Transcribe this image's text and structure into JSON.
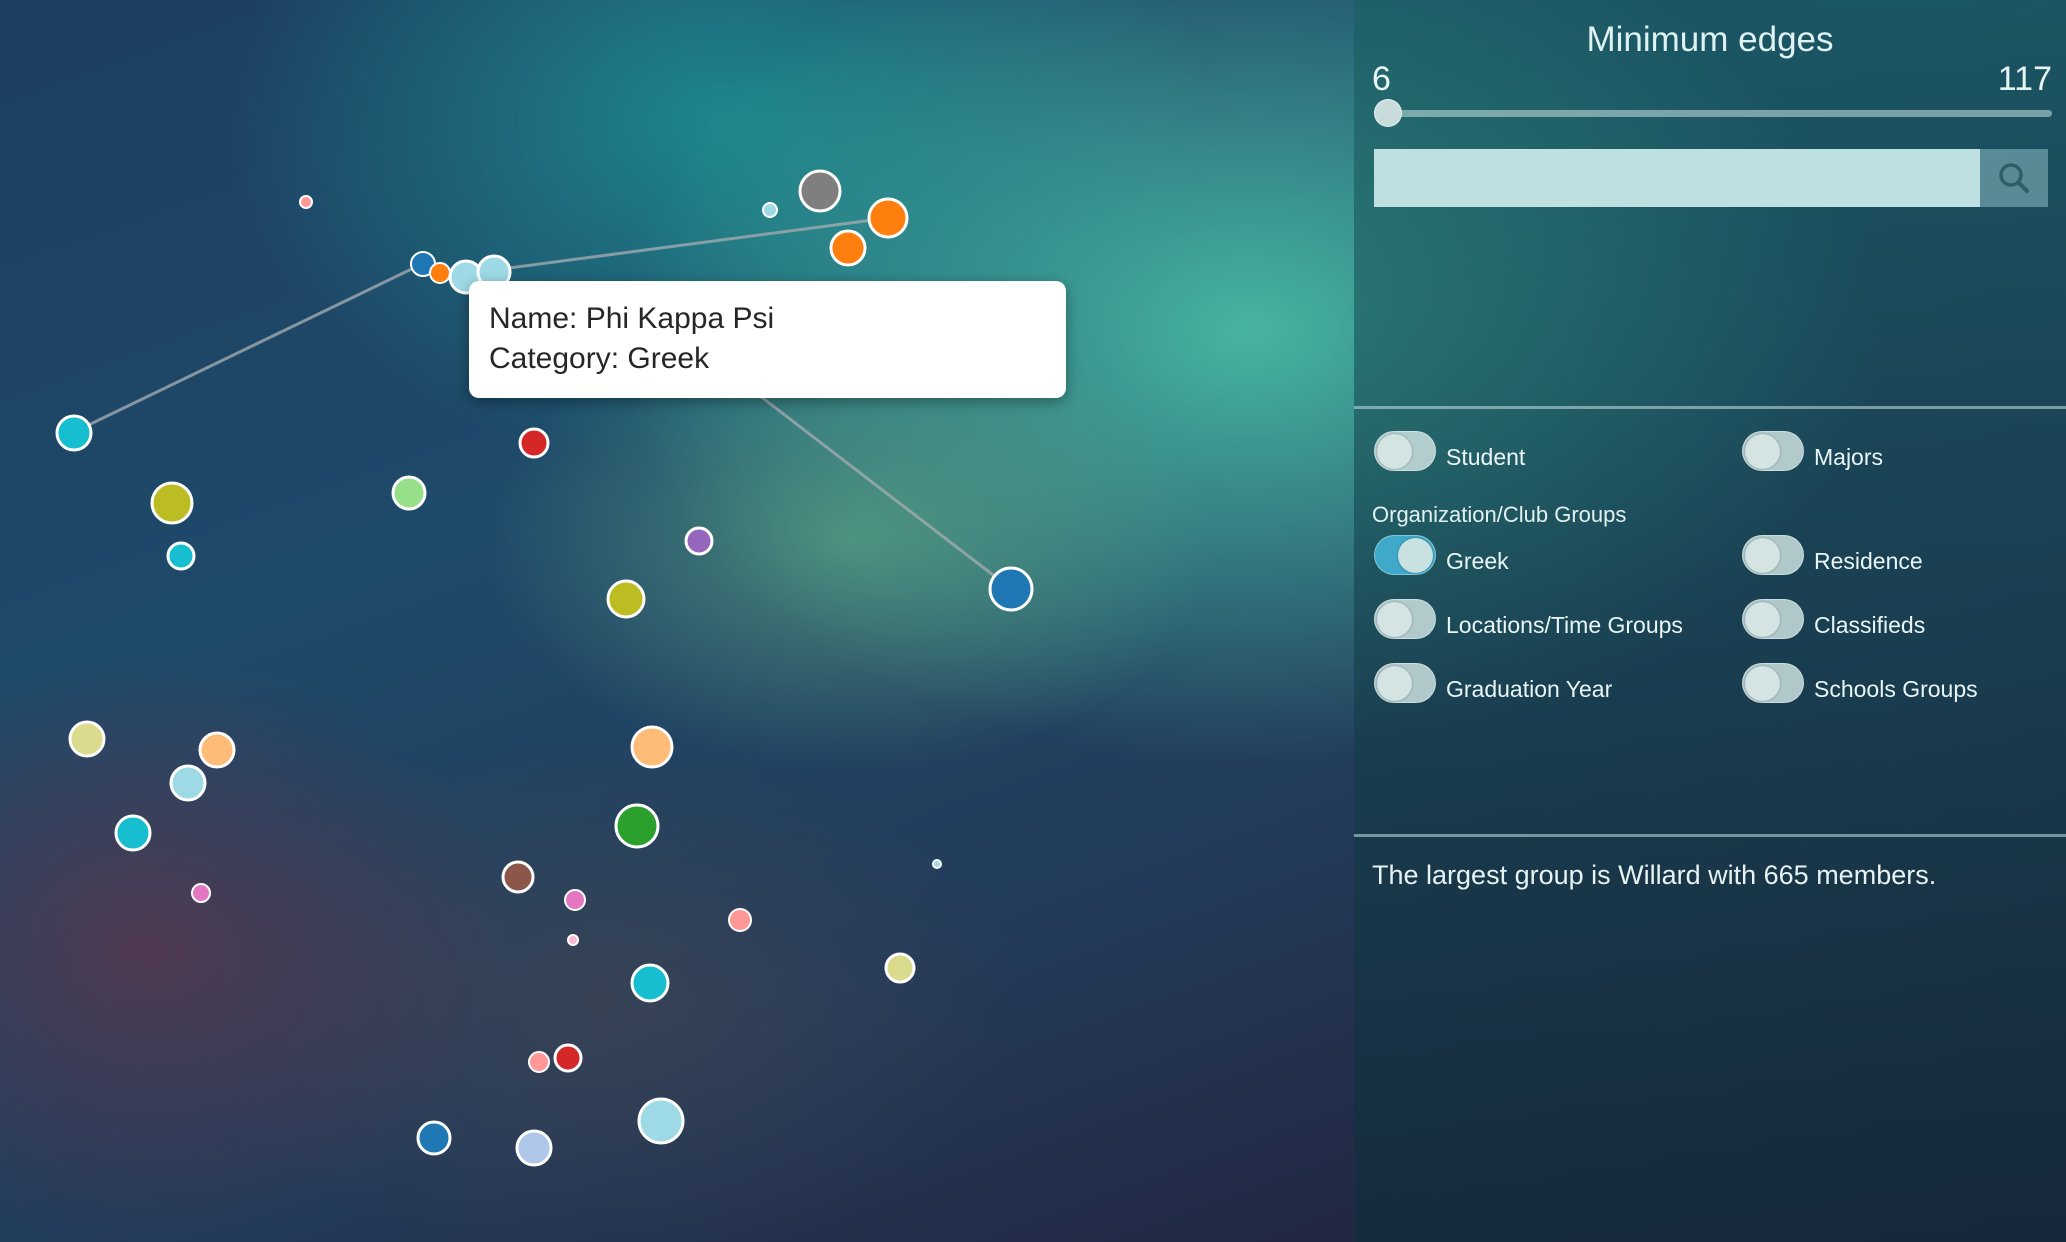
{
  "tooltip": {
    "name_line": "Name: Phi Kappa Psi",
    "category_line": "Category: Greek"
  },
  "slider": {
    "title": "Minimum edges",
    "min_label": "6",
    "max_label": "117",
    "value": 6
  },
  "search": {
    "value": "",
    "placeholder": "",
    "icon": "search-icon"
  },
  "filters": {
    "group_heading": "Organization/Club Groups",
    "toggles": [
      {
        "label": "Student",
        "on": false
      },
      {
        "label": "Majors",
        "on": false
      },
      {
        "label": "Greek",
        "on": true
      },
      {
        "label": "Residence",
        "on": false
      },
      {
        "label": "Locations/Time Groups",
        "on": false
      },
      {
        "label": "Classifieds",
        "on": false
      },
      {
        "label": "Graduation Year",
        "on": false
      },
      {
        "label": "Schools Groups",
        "on": false
      }
    ]
  },
  "info": {
    "text": "The largest group is Willard with 665 members."
  },
  "colors": {
    "accent_toggle_on": "#3fa9c9",
    "tooltip_bg": "#ffffff"
  }
}
